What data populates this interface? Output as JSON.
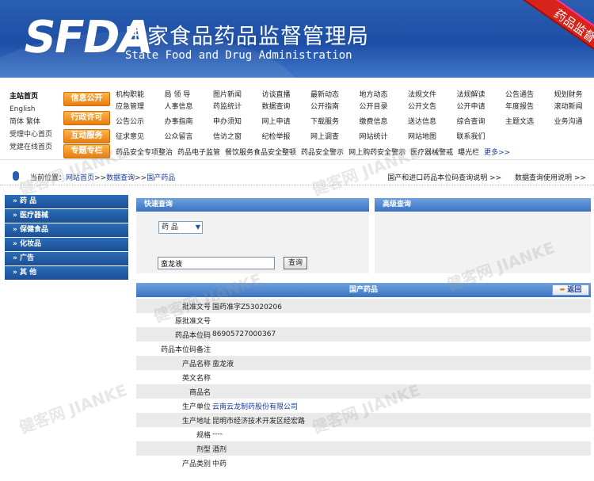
{
  "header": {
    "logo": "SFDA",
    "title_cn": "国家食品药品监督管理局",
    "title_en": "State Food and Drug Administration",
    "ribbon": "药品监督"
  },
  "nav": {
    "left_links": [
      "主站首页",
      "English",
      "简体 繁体",
      "受理中心首页",
      "党建在线首页"
    ],
    "orange_buttons": [
      "信息公开",
      "行政许可",
      "互动服务",
      "专题专栏"
    ],
    "rows": [
      [
        "机构职能",
        "局 领 导",
        "图片新闻",
        "访谈直播",
        "最新动态",
        "地方动态",
        "法规文件",
        "法规解读",
        "公告通告",
        "规划财务"
      ],
      [
        "应急管理",
        "人事信息",
        "药监统计",
        "数据查询",
        "公开指南",
        "公开目录",
        "公开文告",
        "公开申请",
        "年度报告",
        "滚动新闻"
      ],
      [
        "公告公示",
        "办事指南",
        "申办须知",
        "网上申请",
        "下载服务",
        "缴费信息",
        "送达信息",
        "综合查询",
        "主题文选",
        "业务沟通"
      ],
      [
        "征求意见",
        "公众留言",
        "信访之窗",
        "纪检举报",
        "网上调查",
        "网站统计",
        "网站地图",
        "联系我们",
        "",
        ""
      ]
    ],
    "row5": [
      "药品安全专项整治",
      "药品电子监管",
      "餐饮服务食品安全整顿",
      "药品安全警示",
      "网上购药安全警示",
      "医疗器械警戒",
      "曝光栏"
    ],
    "more": "更多>>"
  },
  "breadcrumb": {
    "prefix": "当前位置：",
    "home": "网站首页",
    "sep": ">>",
    "query": "数据查询",
    "current": "国产药品",
    "right_links": [
      "国产和进口药品本位码查询说明 >>",
      "数据查询使用说明 >>"
    ]
  },
  "sidebar": {
    "items": [
      "药 品",
      "医疗器械",
      "保健食品",
      "化妆品",
      "广告",
      "其 他"
    ]
  },
  "quick_search": {
    "title": "快速查询",
    "select_value": "药 品",
    "input_value": "蛮龙液",
    "button": "查询"
  },
  "advanced_search": {
    "title": "高级查询"
  },
  "result": {
    "title": "国产药品",
    "back": "返回",
    "rows": [
      {
        "label": "批准文号",
        "value": "国药准字Z53020206"
      },
      {
        "label": "原批准文号",
        "value": ""
      },
      {
        "label": "药品本位码",
        "value": "86905727000367"
      },
      {
        "label": "药品本位码备注",
        "value": ""
      },
      {
        "label": "产品名称",
        "value": "蛮龙液"
      },
      {
        "label": "英文名称",
        "value": ""
      },
      {
        "label": "商品名",
        "value": ""
      },
      {
        "label": "生产单位",
        "value": "云南云龙制药股份有限公司"
      },
      {
        "label": "生产地址",
        "value": "昆明市经济技术开发区经宏路"
      },
      {
        "label": "规格",
        "value": "----"
      },
      {
        "label": "剂型",
        "value": "酒剂"
      },
      {
        "label": "产品类别",
        "value": "中药"
      }
    ]
  },
  "watermark": "健客网 JIANKE"
}
